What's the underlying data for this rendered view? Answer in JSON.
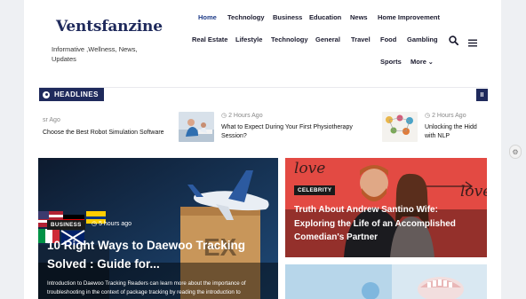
{
  "site": {
    "logo": "Ventsfanzine",
    "tagline": "Informative ,Wellness, News, Updates"
  },
  "nav": {
    "items": [
      "Home",
      "Technology",
      "Business",
      "Education",
      "News",
      "Home Improvement",
      "Real Estate",
      "Lifestyle",
      "Technology",
      "General",
      "Travel",
      "Food",
      "Gambling",
      "Sports",
      "More"
    ],
    "active": "Home",
    "search_icon": "search-icon",
    "menu_icon": "hamburger-menu-icon"
  },
  "headlines": {
    "label": "HEADLINES",
    "pause_label": "II",
    "items": [
      {
        "time": "sr Ago",
        "title": "Choose the Best Robot Simulation Software"
      },
      {
        "time": "2 Hours Ago",
        "title": "What to Expect During Your First Physiotherapy Session?"
      },
      {
        "time": "2 Hours Ago",
        "title": "Unlocking the Hidd with NLP"
      }
    ]
  },
  "cards": {
    "main": {
      "category": "BUSINESS",
      "time": "5 hours ago",
      "title": "10 Right Ways to Daewoo Tracking Solved : Guide for...",
      "excerpt": "Introduction to Daewoo Tracking Readers can learn more about the importance of troubleshooting in the context of package tracking by reading the introduction to"
    },
    "side": {
      "category": "CELEBRITY",
      "title": "Truth About Andrew Santino Wife: Exploring the Life of an Accomplished Comedian's Partner",
      "image_text_1": "love",
      "image_text_2": "love"
    }
  },
  "colors": {
    "brand": "#1f2a5c",
    "side_card_bg": "#e34a43"
  }
}
